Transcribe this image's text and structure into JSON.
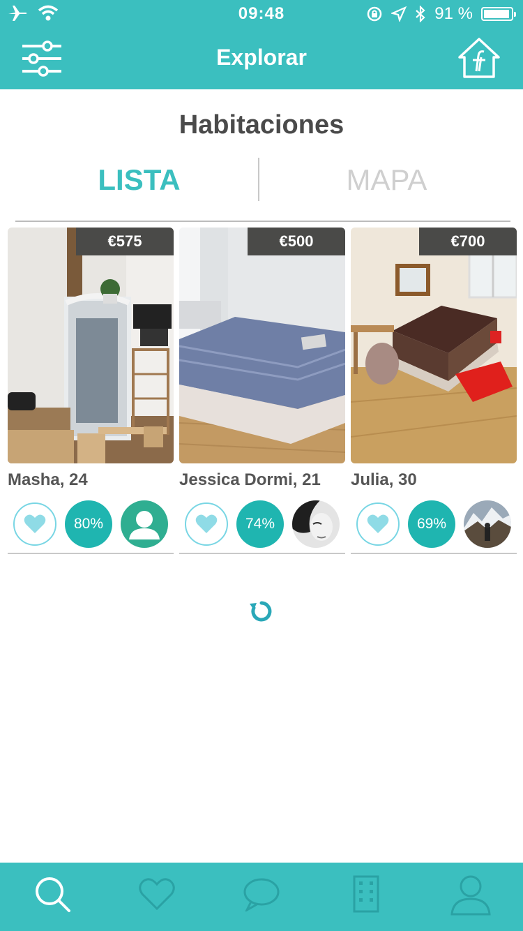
{
  "status_bar": {
    "time": "09:48",
    "battery": "91 %"
  },
  "nav": {
    "title": "Explorar"
  },
  "section": {
    "title": "Habitaciones"
  },
  "view_toggle": {
    "list": "LISTA",
    "map": "MAPA",
    "selected": "LISTA"
  },
  "listings": [
    {
      "price": "€575",
      "name": "Masha, 24",
      "match": "80%"
    },
    {
      "price": "€500",
      "name": "Jessica Dormi, 21",
      "match": "74%"
    },
    {
      "price": "€700",
      "name": "Julia, 30",
      "match": "69%"
    }
  ],
  "tab_bar": {
    "items": [
      "search-icon",
      "heart-icon",
      "chat-icon",
      "building-icon",
      "profile-icon"
    ],
    "active": "search-icon"
  },
  "colors": {
    "brand": "#3bbfbf",
    "match": "#1fb5b0",
    "heart": "#79d6e4"
  }
}
